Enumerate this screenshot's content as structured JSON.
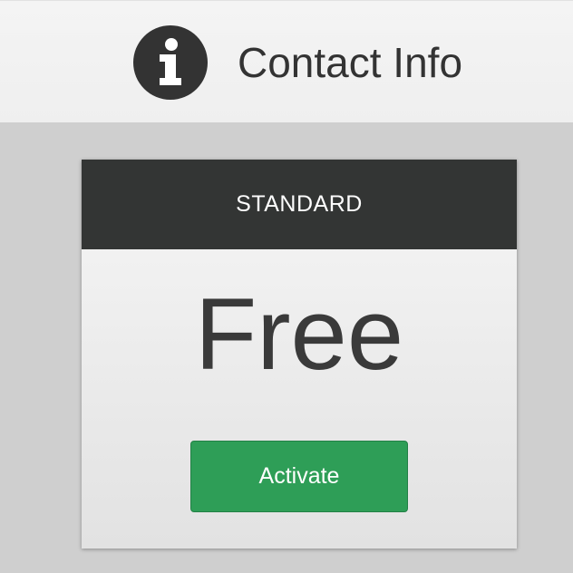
{
  "header": {
    "title": "Contact Info",
    "icon": "info-icon"
  },
  "plan": {
    "name": "STANDARD",
    "price": "Free",
    "action_label": "Activate"
  },
  "colors": {
    "header_bg": "#f2f2f2",
    "page_bg": "#cfcfcf",
    "card_head_bg": "#333534",
    "accent_green": "#2e9e57",
    "text_dark": "#333333"
  }
}
